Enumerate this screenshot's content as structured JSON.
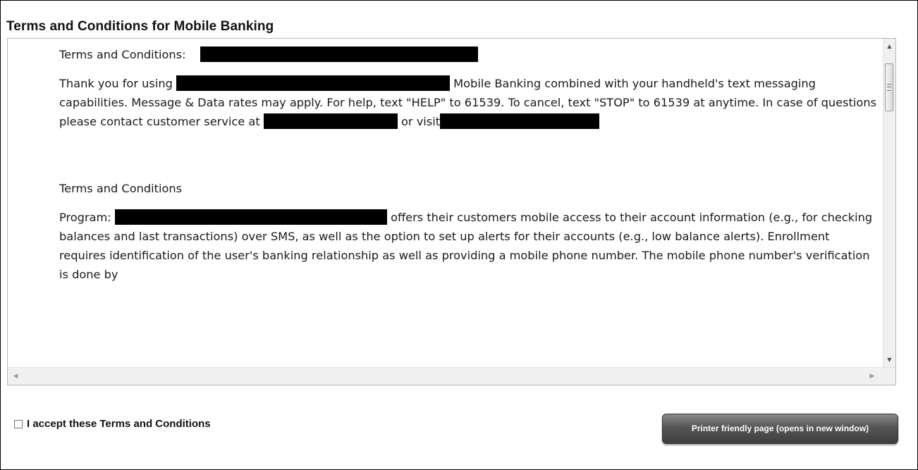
{
  "page": {
    "title": "Terms and Conditions for Mobile Banking"
  },
  "terms": {
    "heading_prefix": "Terms and Conditions:",
    "intro_part1": "Thank you for using",
    "intro_part2": " Mobile Banking combined with your handheld's text messaging capabilities.  Message & Data rates may apply. For help, text \"HELP\" to 61539. To cancel, text \"STOP\" to 61539 at anytime. In case of questions please contact customer service at",
    "intro_part3": " or visit",
    "section_heading": "Terms and Conditions",
    "program_label": "Program:",
    "program_text": " offers their customers mobile access to their account information (e.g., for checking balances and last transactions) over SMS, as well as the option to set up alerts for their accounts (e.g., low balance alerts).  Enrollment requires identification of the user's banking relationship as well as providing a mobile phone number.  The mobile phone number's verification is done by"
  },
  "scrollbars": {
    "up_arrow_icon": "triangle-up-icon",
    "down_arrow_icon": "triangle-down-icon",
    "left_arrow_icon": "triangle-left-icon",
    "right_arrow_icon": "triangle-right-icon"
  },
  "footer": {
    "accept_label": "I accept these Terms and Conditions",
    "accept_checked": false,
    "print_button_label": "Printer friendly page (opens in new window)"
  }
}
